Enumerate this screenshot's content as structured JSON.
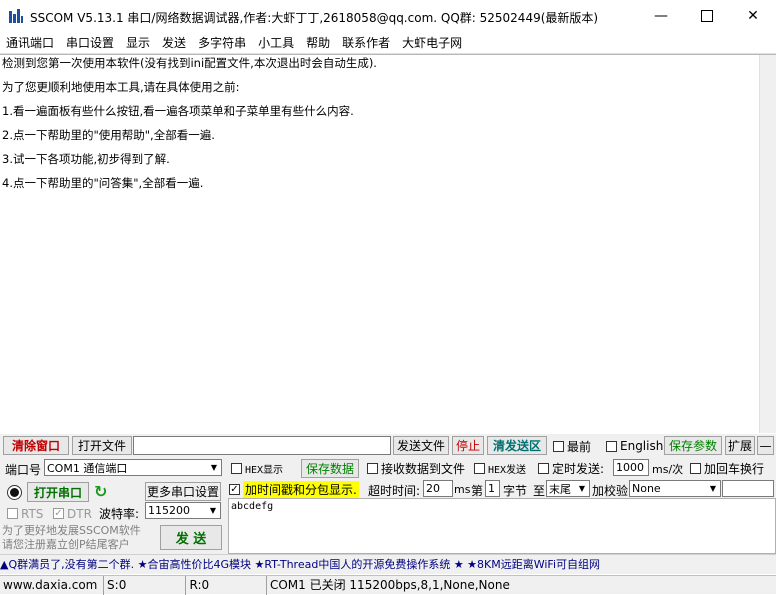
{
  "window": {
    "title": "SSCOM V5.13.1 串口/网络数据调试器,作者:大虾丁丁,2618058@qq.com. QQ群:  52502449(最新版本)",
    "app_icon": "sscom-logo-icon",
    "minimize_icon": "minimize-icon",
    "maximize_icon": "maximize-icon",
    "close_icon": "close-icon"
  },
  "menu": [
    "通讯端口",
    "串口设置",
    "显示",
    "发送",
    "多字符串",
    "小工具",
    "帮助",
    "联系作者",
    "大虾电子网"
  ],
  "receive": {
    "lines": [
      "检测到您第一次使用本软件(没有找到ini配置文件,本次退出时会自动生成).",
      "为了您更顺利地使用本工具,请在具体使用之前:",
      "1.看一遍面板有些什么按钮,看一遍各项菜单和子菜单里有些什么内容.",
      "2.点一下帮助里的\"使用帮助\",全部看一遍.",
      "3.试一下各项功能,初步得到了解.",
      "4.点一下帮助里的\"问答集\",全部看一遍."
    ]
  },
  "toolbar": {
    "clear": "清除窗口",
    "open_file": "打开文件",
    "file_path": "",
    "send_file": "发送文件",
    "stop": "停止",
    "clear_send": "清发送区",
    "topmost": "最前",
    "english": "English",
    "save_params": "保存参数",
    "expand": "扩展",
    "collapse": "—"
  },
  "row1": {
    "port_label": "端口号",
    "port_value": "COM1 通信端口",
    "hex_display": "HEX显示",
    "save_data": "保存数据",
    "recv_to_file": "接收数据到文件",
    "hex_send": "HEX发送",
    "timed_send": "定时发送:",
    "interval": "1000",
    "interval_unit": "ms/次",
    "add_crlf": "加回车换行"
  },
  "row2": {
    "open_port": "打开串口",
    "more_settings": "更多串口设置",
    "timestamp": "加时间戳和分包显示.",
    "timestamp_checked": true,
    "timeout_label": "超时时间:",
    "timeout_value": "20",
    "timeout_unit": "ms",
    "byte_prefix": "第",
    "byte_index": "1",
    "byte_label": "字节",
    "to_label": "至",
    "to_value": "末尾",
    "checksum_label": "加校验",
    "checksum_value": "None"
  },
  "row3": {
    "rts": "RTS",
    "dtr": "DTR",
    "dtr_checked": true,
    "baud_label": "波特率:",
    "baud_value": "115200"
  },
  "send": {
    "text": "abcdefg",
    "button": "发 送",
    "promo_line1": "为了更好地发展SSCOM软件",
    "promo_line2": "请您注册嘉立创P结尾客户"
  },
  "marquee": "▲Q群满员了,没有第二个群. ★合宙高性价比4G模块 ★RT-Thread中国人的开源免费操作系统 ★ ★8KM远距离WiFi可自组网",
  "status": {
    "website": "www.daxia.com",
    "sent": "S:0",
    "received": "R:0",
    "port_status": "COM1 已关闭  115200bps,8,1,None,None"
  },
  "colors": {
    "danger": "#c00000",
    "accent_green": "#008000",
    "highlight_yellow": "#ffff00",
    "marquee_text": "#000080"
  }
}
